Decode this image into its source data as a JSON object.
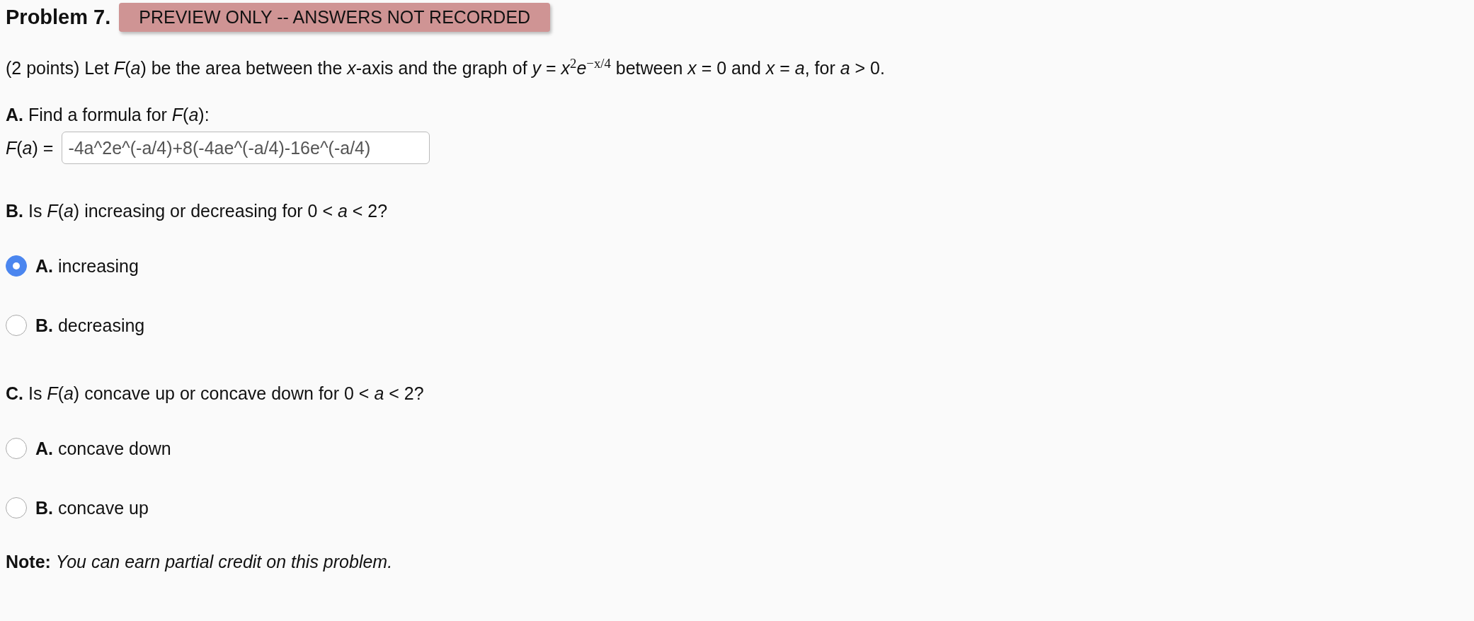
{
  "problem": {
    "title": "Problem 7.",
    "badge": "PREVIEW ONLY -- ANSWERS NOT RECORDED"
  },
  "statement": "(2 points) Let *F*(*a*) be the area between the *x*-axis and the graph of *y* = *x*$^{2}$*e*$^{−x/4}$ between *x* = 0 and *x* = *a*, for *a* > 0.",
  "parts": [
    {
      "kind": "formula",
      "prompt": "**A.** Find a formula for *F*(*a*):",
      "label": "*F*(*a*) =",
      "value": "-4a^2e^(-a/4)+8(-4ae^(-a/4)-16e^(-a/4)"
    },
    {
      "kind": "choice",
      "prompt": "**B.** Is *F*(*a*) increasing or decreasing for 0 < *a* < 2?",
      "options": [
        {
          "label": "**A.** increasing",
          "selected": true
        },
        {
          "label": "**B.** decreasing",
          "selected": false
        }
      ]
    },
    {
      "kind": "choice",
      "prompt": "**C.** Is *F*(*a*) concave up or concave down for 0 < *a* < 2?",
      "options": [
        {
          "label": "**A.** concave down",
          "selected": false
        },
        {
          "label": "**B.** concave up",
          "selected": false
        }
      ]
    }
  ],
  "note": "**Note:** *You can earn partial credit on this problem.*"
}
